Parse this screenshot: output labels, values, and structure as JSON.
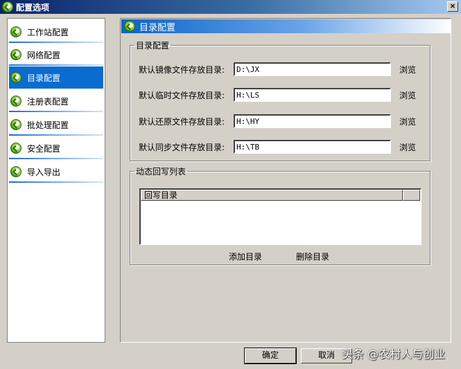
{
  "window": {
    "title": "配置选项",
    "close_label": "×"
  },
  "sidebar": {
    "items": [
      {
        "label": "工作站配置"
      },
      {
        "label": "网络配置"
      },
      {
        "label": "目录配置"
      },
      {
        "label": "注册表配置"
      },
      {
        "label": "批处理配置"
      },
      {
        "label": "安全配置"
      },
      {
        "label": "导入导出"
      }
    ],
    "active_index": 2
  },
  "panel": {
    "title": "目录配置",
    "dir_group": {
      "legend": "目录配置",
      "rows": [
        {
          "label": "默认镜像文件存放目录:",
          "value": "D:\\JX",
          "browse": "浏览"
        },
        {
          "label": "默认临时文件存放目录:",
          "value": "H:\\LS",
          "browse": "浏览"
        },
        {
          "label": "默认还原文件存放目录:",
          "value": "H:\\HY",
          "browse": "浏览"
        },
        {
          "label": "默认同步文件存放目录:",
          "value": "H:\\TB",
          "browse": "浏览"
        }
      ]
    },
    "writeback_group": {
      "legend": "动态回写列表",
      "column": "回写目录",
      "add_label": "添加目录",
      "delete_label": "删除目录"
    }
  },
  "footer": {
    "ok_label": "确定",
    "cancel_label": "取消"
  },
  "watermark": "头条 @农村人与创业",
  "colors": {
    "accent": "#0a6cd0",
    "title_bar": "#0a246a",
    "face": "#d4d0c8"
  }
}
